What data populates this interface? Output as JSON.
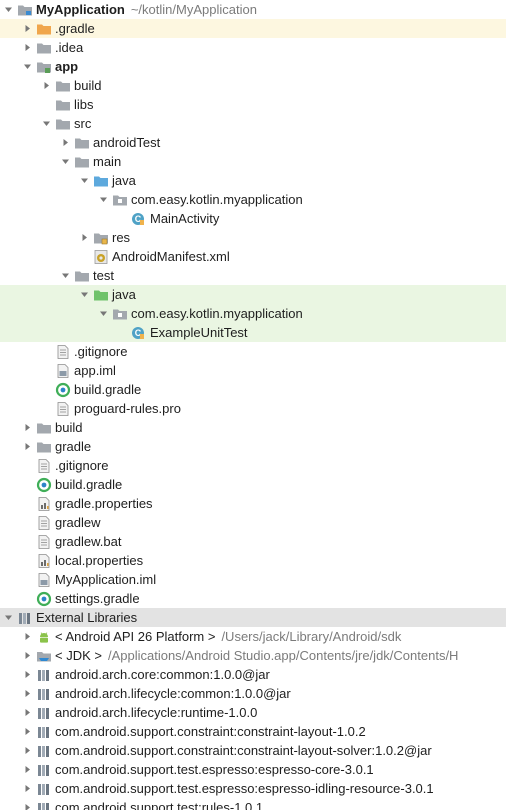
{
  "tree": [
    {
      "level": 0,
      "arrow": "down",
      "icon": "project-folder-icon",
      "label": "MyApplication",
      "bold": true,
      "path": "~/kotlin/MyApplication"
    },
    {
      "level": 1,
      "arrow": "right",
      "icon": "folder-orange-icon",
      "label": ".gradle",
      "hl": "orange"
    },
    {
      "level": 1,
      "arrow": "right",
      "icon": "folder-icon",
      "label": ".idea"
    },
    {
      "level": 1,
      "arrow": "down",
      "icon": "module-folder-icon",
      "label": "app",
      "bold": true
    },
    {
      "level": 2,
      "arrow": "right",
      "icon": "folder-icon",
      "label": "build"
    },
    {
      "level": 2,
      "arrow": "none",
      "icon": "folder-icon",
      "label": "libs"
    },
    {
      "level": 2,
      "arrow": "down",
      "icon": "folder-icon",
      "label": "src"
    },
    {
      "level": 3,
      "arrow": "right",
      "icon": "folder-icon",
      "label": "androidTest"
    },
    {
      "level": 3,
      "arrow": "down",
      "icon": "folder-icon",
      "label": "main"
    },
    {
      "level": 4,
      "arrow": "down",
      "icon": "source-folder-icon",
      "label": "java"
    },
    {
      "level": 5,
      "arrow": "down",
      "icon": "package-icon",
      "label": "com.easy.kotlin.myapplication"
    },
    {
      "level": 6,
      "arrow": "none",
      "icon": "class-icon",
      "label": "MainActivity"
    },
    {
      "level": 4,
      "arrow": "right",
      "icon": "resource-folder-icon",
      "label": "res"
    },
    {
      "level": 4,
      "arrow": "none",
      "icon": "manifest-icon",
      "label": "AndroidManifest.xml"
    },
    {
      "level": 3,
      "arrow": "down",
      "icon": "folder-icon",
      "label": "test"
    },
    {
      "level": 4,
      "arrow": "down",
      "icon": "test-source-folder-icon",
      "label": "java",
      "hl": "green"
    },
    {
      "level": 5,
      "arrow": "down",
      "icon": "package-icon",
      "label": "com.easy.kotlin.myapplication",
      "hl": "green"
    },
    {
      "level": 6,
      "arrow": "none",
      "icon": "class-icon",
      "label": "ExampleUnitTest",
      "hl": "green"
    },
    {
      "level": 2,
      "arrow": "none",
      "icon": "text-file-icon",
      "label": ".gitignore"
    },
    {
      "level": 2,
      "arrow": "none",
      "icon": "iml-file-icon",
      "label": "app.iml"
    },
    {
      "level": 2,
      "arrow": "none",
      "icon": "gradle-icon",
      "label": "build.gradle"
    },
    {
      "level": 2,
      "arrow": "none",
      "icon": "text-file-icon",
      "label": "proguard-rules.pro"
    },
    {
      "level": 1,
      "arrow": "right",
      "icon": "folder-icon",
      "label": "build"
    },
    {
      "level": 1,
      "arrow": "right",
      "icon": "folder-icon",
      "label": "gradle"
    },
    {
      "level": 1,
      "arrow": "none",
      "icon": "text-file-icon",
      "label": ".gitignore"
    },
    {
      "level": 1,
      "arrow": "none",
      "icon": "gradle-icon",
      "label": "build.gradle"
    },
    {
      "level": 1,
      "arrow": "none",
      "icon": "properties-icon",
      "label": "gradle.properties"
    },
    {
      "level": 1,
      "arrow": "none",
      "icon": "text-file-icon",
      "label": "gradlew"
    },
    {
      "level": 1,
      "arrow": "none",
      "icon": "text-file-icon",
      "label": "gradlew.bat"
    },
    {
      "level": 1,
      "arrow": "none",
      "icon": "properties-icon",
      "label": "local.properties"
    },
    {
      "level": 1,
      "arrow": "none",
      "icon": "iml-file-icon",
      "label": "MyApplication.iml"
    },
    {
      "level": 1,
      "arrow": "none",
      "icon": "gradle-icon",
      "label": "settings.gradle"
    },
    {
      "level": 0,
      "arrow": "down",
      "icon": "library-icon",
      "label": "External Libraries",
      "section": true
    },
    {
      "level": 1,
      "arrow": "right",
      "icon": "android-icon",
      "label": "< Android API 26 Platform >",
      "path": "/Users/jack/Library/Android/sdk"
    },
    {
      "level": 1,
      "arrow": "right",
      "icon": "jdk-icon",
      "label": "< JDK >",
      "path": "/Applications/Android Studio.app/Contents/jre/jdk/Contents/H"
    },
    {
      "level": 1,
      "arrow": "right",
      "icon": "library-icon",
      "label": "android.arch.core:common:1.0.0@jar"
    },
    {
      "level": 1,
      "arrow": "right",
      "icon": "library-icon",
      "label": "android.arch.lifecycle:common:1.0.0@jar"
    },
    {
      "level": 1,
      "arrow": "right",
      "icon": "library-icon",
      "label": "android.arch.lifecycle:runtime-1.0.0"
    },
    {
      "level": 1,
      "arrow": "right",
      "icon": "library-icon",
      "label": "com.android.support.constraint:constraint-layout-1.0.2"
    },
    {
      "level": 1,
      "arrow": "right",
      "icon": "library-icon",
      "label": "com.android.support.constraint:constraint-layout-solver:1.0.2@jar"
    },
    {
      "level": 1,
      "arrow": "right",
      "icon": "library-icon",
      "label": "com.android.support.test.espresso:espresso-core-3.0.1"
    },
    {
      "level": 1,
      "arrow": "right",
      "icon": "library-icon",
      "label": "com.android.support.test.espresso:espresso-idling-resource-3.0.1"
    },
    {
      "level": 1,
      "arrow": "right",
      "icon": "library-icon",
      "label": "com.android.support.test:rules-1.0.1"
    }
  ],
  "colors": {
    "folder": "#a3a8ae",
    "folder_orange": "#f0a64c",
    "source_folder": "#5da9dd",
    "test_folder": "#6fc36a",
    "highlight_orange": "#fdf7e0",
    "highlight_green": "#eaf6e2",
    "section_bg": "#e3e3e3"
  }
}
